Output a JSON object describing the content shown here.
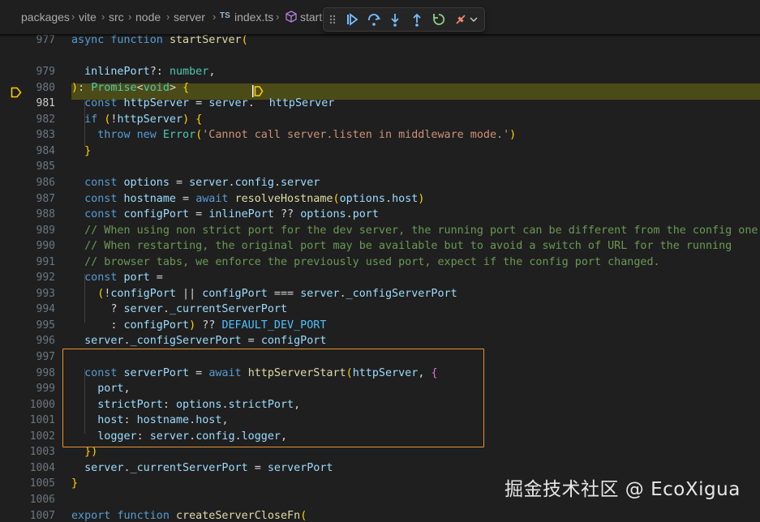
{
  "breadcrumb": {
    "items": [
      "packages",
      "vite",
      "src",
      "node",
      "server",
      "index.ts",
      "start"
    ],
    "file_badge": "TS",
    "symbol_icon": "cube-symbol-icon"
  },
  "debug_toolbar": {
    "controls": [
      "drag-handle-icon",
      "continue-icon",
      "step-over-icon",
      "step-into-icon",
      "step-out-icon",
      "restart-icon",
      "connect-icon",
      "chevron-down-icon"
    ]
  },
  "editor": {
    "current_line": 981,
    "lines": [
      {
        "n": 977,
        "t": "async function startServer("
      },
      {
        "n": 979,
        "t": "  inlinePort?: number,"
      },
      {
        "n": 980,
        "t": "): Promise<void> {"
      },
      {
        "n": 981,
        "t": "  const httpServer = server.httpServer"
      },
      {
        "n": 982,
        "t": "  if (!httpServer) {"
      },
      {
        "n": 983,
        "t": "    throw new Error('Cannot call server.listen in middleware mode.')"
      },
      {
        "n": 984,
        "t": "  }"
      },
      {
        "n": 985,
        "t": ""
      },
      {
        "n": 986,
        "t": "  const options = server.config.server"
      },
      {
        "n": 987,
        "t": "  const hostname = await resolveHostname(options.host)"
      },
      {
        "n": 988,
        "t": "  const configPort = inlinePort ?? options.port"
      },
      {
        "n": 989,
        "t": "  // When using non strict port for the dev server, the running port can be different from the config one."
      },
      {
        "n": 990,
        "t": "  // When restarting, the original port may be available but to avoid a switch of URL for the running"
      },
      {
        "n": 991,
        "t": "  // browser tabs, we enforce the previously used port, expect if the config port changed."
      },
      {
        "n": 992,
        "t": "  const port ="
      },
      {
        "n": 993,
        "t": "    (!configPort || configPort === server._configServerPort"
      },
      {
        "n": 994,
        "t": "      ? server._currentServerPort"
      },
      {
        "n": 995,
        "t": "      : configPort) ?? DEFAULT_DEV_PORT"
      },
      {
        "n": 996,
        "t": "  server._configServerPort = configPort"
      },
      {
        "n": 997,
        "t": ""
      },
      {
        "n": 998,
        "t": "  const serverPort = await httpServerStart(httpServer, {"
      },
      {
        "n": 999,
        "t": "    port,"
      },
      {
        "n": 1000,
        "t": "    strictPort: options.strictPort,"
      },
      {
        "n": 1001,
        "t": "    host: hostname.host,"
      },
      {
        "n": 1002,
        "t": "    logger: server.config.logger,"
      },
      {
        "n": 1003,
        "t": "  })"
      },
      {
        "n": 1004,
        "t": "  server._currentServerPort = serverPort"
      },
      {
        "n": 1005,
        "t": "}"
      },
      {
        "n": 1006,
        "t": ""
      },
      {
        "n": 1007,
        "t": "export function createServerCloseFn("
      }
    ]
  },
  "colors": {
    "highlight_box": "#e8922e",
    "breakpoint": "#ffcc00",
    "current_line_bg": "#4b4b18"
  },
  "watermark": "掘金技术社区 @ EcoXigua"
}
